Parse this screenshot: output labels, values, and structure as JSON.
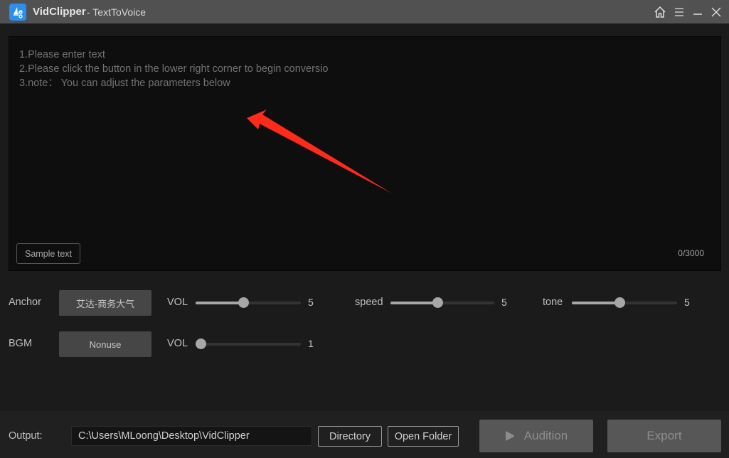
{
  "titlebar": {
    "app_name": "VidClipper",
    "subtitle": "- TextToVoice",
    "icons": [
      "home-icon",
      "menu-icon",
      "minimize-icon",
      "close-icon"
    ]
  },
  "editor": {
    "hint_lines": [
      "1.Please enter text",
      "2.Please click the button in the lower right corner to begin conversio",
      "3.note： You can adjust the parameters below"
    ],
    "value": "",
    "sample_button": "Sample text",
    "char_count": "0/3000",
    "annotation_color": "#ff2a1a"
  },
  "anchor": {
    "label": "Anchor",
    "selected": "艾达-商务大气",
    "vol_label": "VOL",
    "vol_value": "5",
    "vol_fraction": 0.45,
    "speed_label": "speed",
    "speed_value": "5",
    "speed_fraction": 0.45,
    "tone_label": "tone",
    "tone_value": "5",
    "tone_fraction": 0.45
  },
  "bgm": {
    "label": "BGM",
    "selected": "Nonuse",
    "vol_label": "VOL",
    "vol_value": "1",
    "vol_fraction": 0.05
  },
  "footer": {
    "output_label": "Output:",
    "output_path": "C:\\Users\\MLoong\\Desktop\\VidClipper",
    "directory_button": "Directory",
    "open_folder_button": "Open Folder",
    "audition_button": "Audition",
    "export_button": "Export"
  },
  "colors": {
    "brand": "#2b8ff0",
    "titlebar": "#515151",
    "background": "#1b1b1b",
    "editor_bg": "#0e0e0e",
    "slider_fill": "#a7a7a7",
    "button_disabled": "#575757"
  }
}
